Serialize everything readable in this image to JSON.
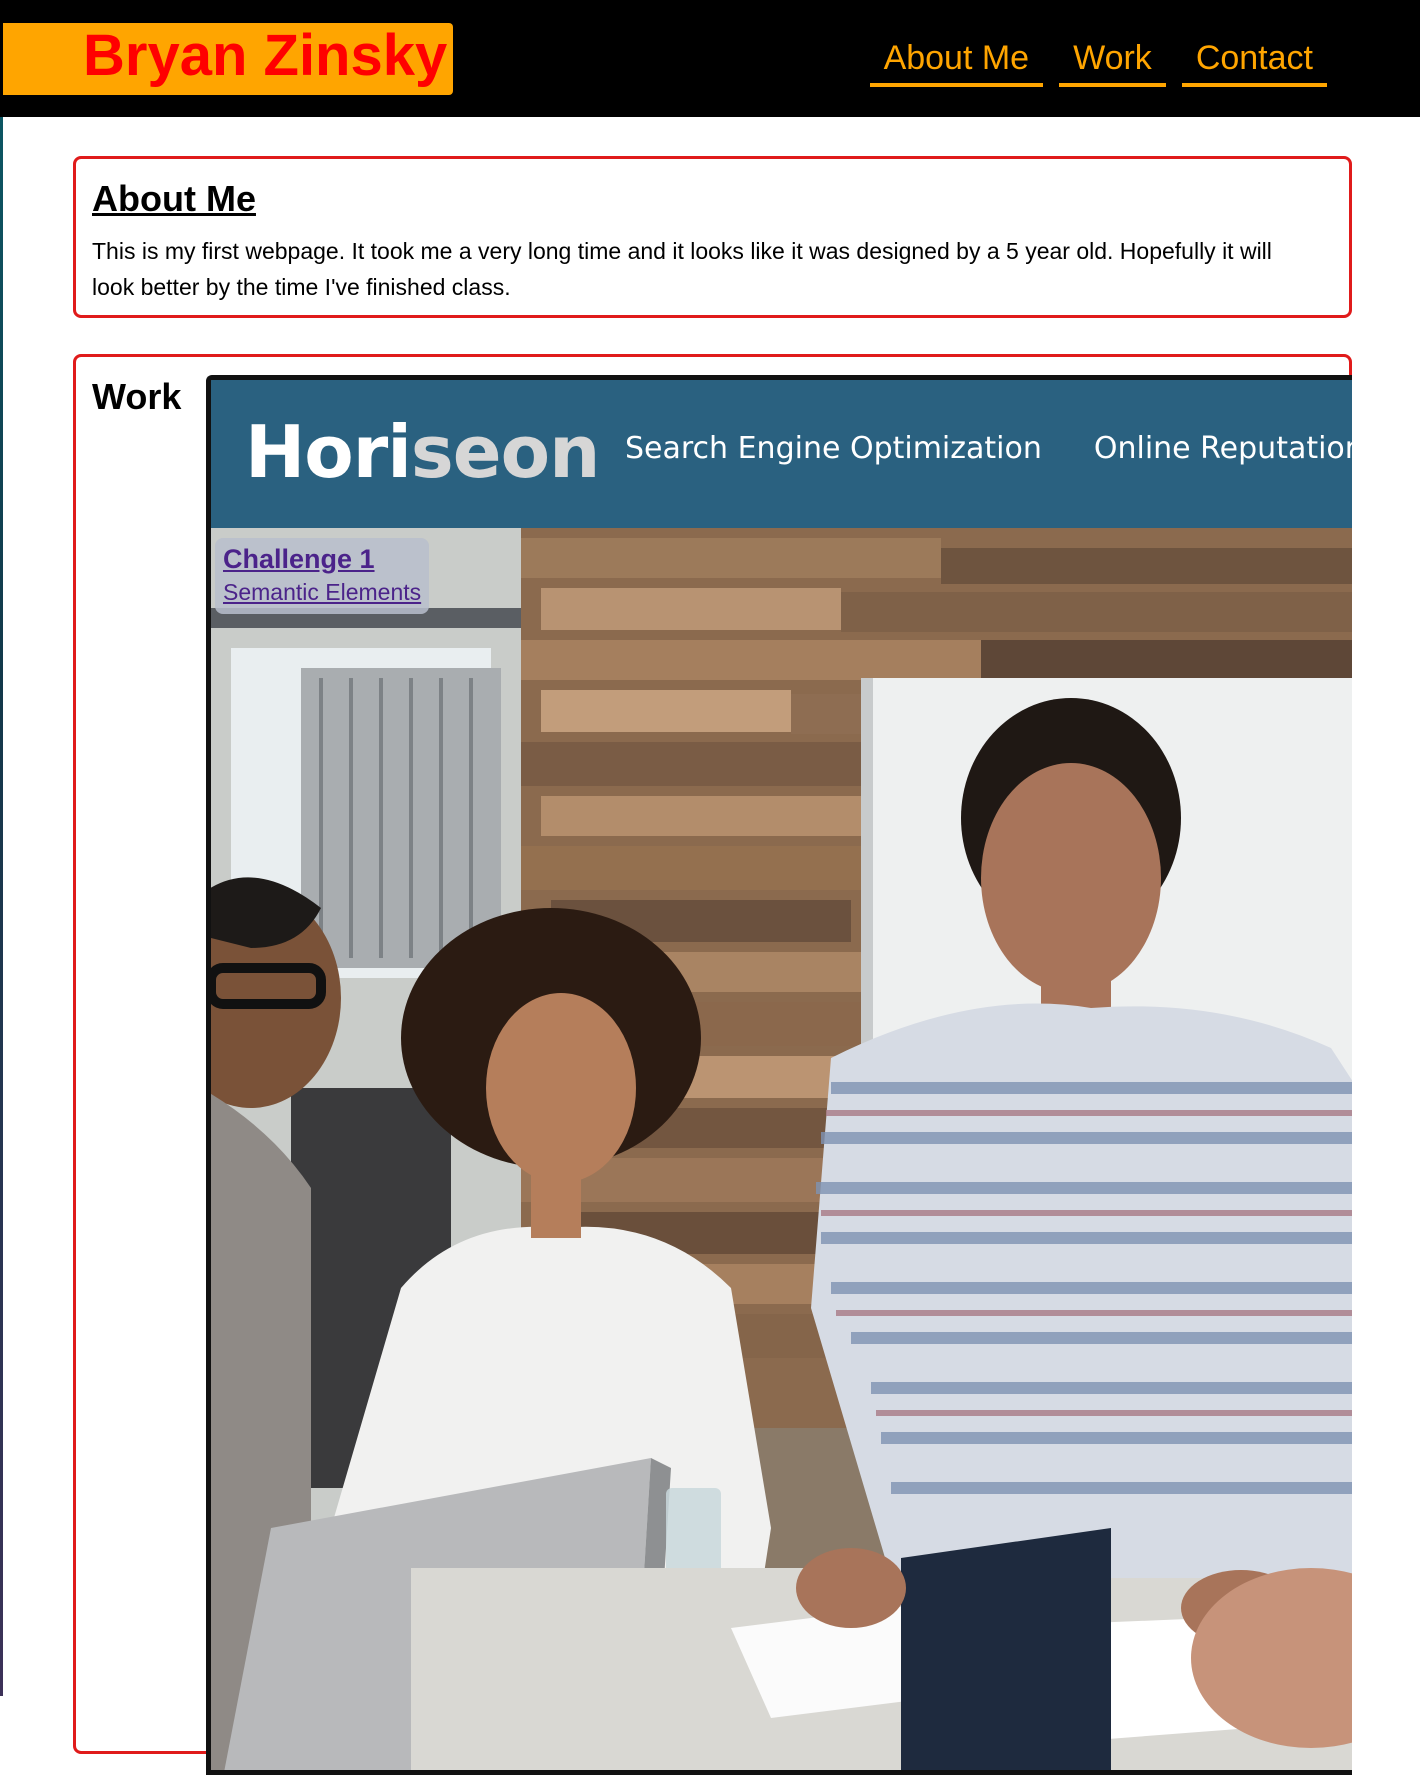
{
  "header": {
    "name": "Bryan Zinsky",
    "nav": [
      "About Me",
      "Work",
      "Contact"
    ]
  },
  "about": {
    "heading": "About Me",
    "text": "This is my first webpage. It took me a very long time and it looks like it was designed by a 5 year old. Hopefully it will look better by the time I've finished class."
  },
  "work": {
    "heading": "Work",
    "project": {
      "logo_main": "Hori",
      "logo_light": "seon",
      "nav": [
        "Search Engine Optimization",
        "Online Reputation Management"
      ],
      "title": "Challenge 1",
      "subtitle": "Semantic Elements"
    }
  },
  "colors": {
    "header_bg": "#000000",
    "brand_bg": "#ffa500",
    "brand_text": "#ff0000",
    "nav_text": "#ffa500",
    "card_border": "#e01b1b",
    "horiseon_bar": "#2a6180",
    "link": "#4b238a"
  },
  "icons": {
    "project_image": "team-meeting-photo"
  }
}
